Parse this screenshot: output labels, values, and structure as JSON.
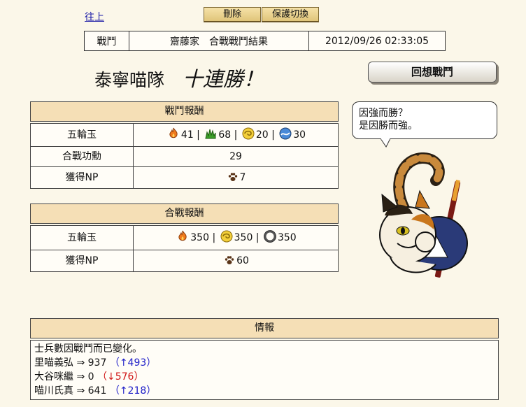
{
  "nav": {
    "top_link": "往上"
  },
  "toolbar": {
    "delete_label": "刪除",
    "protect_label": "保護切換"
  },
  "battle_info": {
    "type": "戰鬥",
    "title": "齋藤家　合戰戰鬥結果",
    "timestamp": "2012/09/26 02:33:05"
  },
  "headline": {
    "team": "泰寧喵隊",
    "streak": "十連勝！"
  },
  "replay_label": "回想戰鬥",
  "speech": {
    "line1": "因強而勝？",
    "line2": "是因勝而強。"
  },
  "battle_reward": {
    "title": "戰鬥報酬",
    "rows": [
      {
        "label": "五輪玉",
        "gems": [
          {
            "icon": "fire-gem-icon",
            "value": "41"
          },
          {
            "icon": "grass-gem-icon",
            "value": "68"
          },
          {
            "icon": "wind-gem-icon",
            "value": "20"
          },
          {
            "icon": "water-gem-icon",
            "value": "30"
          }
        ]
      },
      {
        "label": "合戰功勳",
        "value": "29"
      },
      {
        "label": "獲得NP",
        "value": "7",
        "icon": "paw-icon"
      }
    ]
  },
  "war_reward": {
    "title": "合戰報酬",
    "rows": [
      {
        "label": "五輪玉",
        "gems": [
          {
            "icon": "fire-gem-icon",
            "value": "350"
          },
          {
            "icon": "wind-gem-icon",
            "value": "350"
          },
          {
            "icon": "void-gem-icon",
            "value": "350"
          }
        ]
      },
      {
        "label": "獲得NP",
        "value": "60",
        "icon": "paw-icon"
      }
    ]
  },
  "report": {
    "title": "情報",
    "intro": "士兵數因戰鬥而已變化。",
    "entries": [
      {
        "name": "里喵義弘",
        "value": "937",
        "delta": "↑493",
        "dir": "up"
      },
      {
        "name": "大谷咪繼",
        "value": "0",
        "delta": "↓576",
        "dir": "down"
      },
      {
        "name": "喵川氏真",
        "value": "641",
        "delta": "↑218",
        "dir": "up"
      }
    ]
  },
  "colors": {
    "background": "#fbf7e9",
    "header_bg": "#f5dfb6",
    "up": "#1c1cc8",
    "down": "#d01515",
    "link": "#1a1aa6"
  }
}
